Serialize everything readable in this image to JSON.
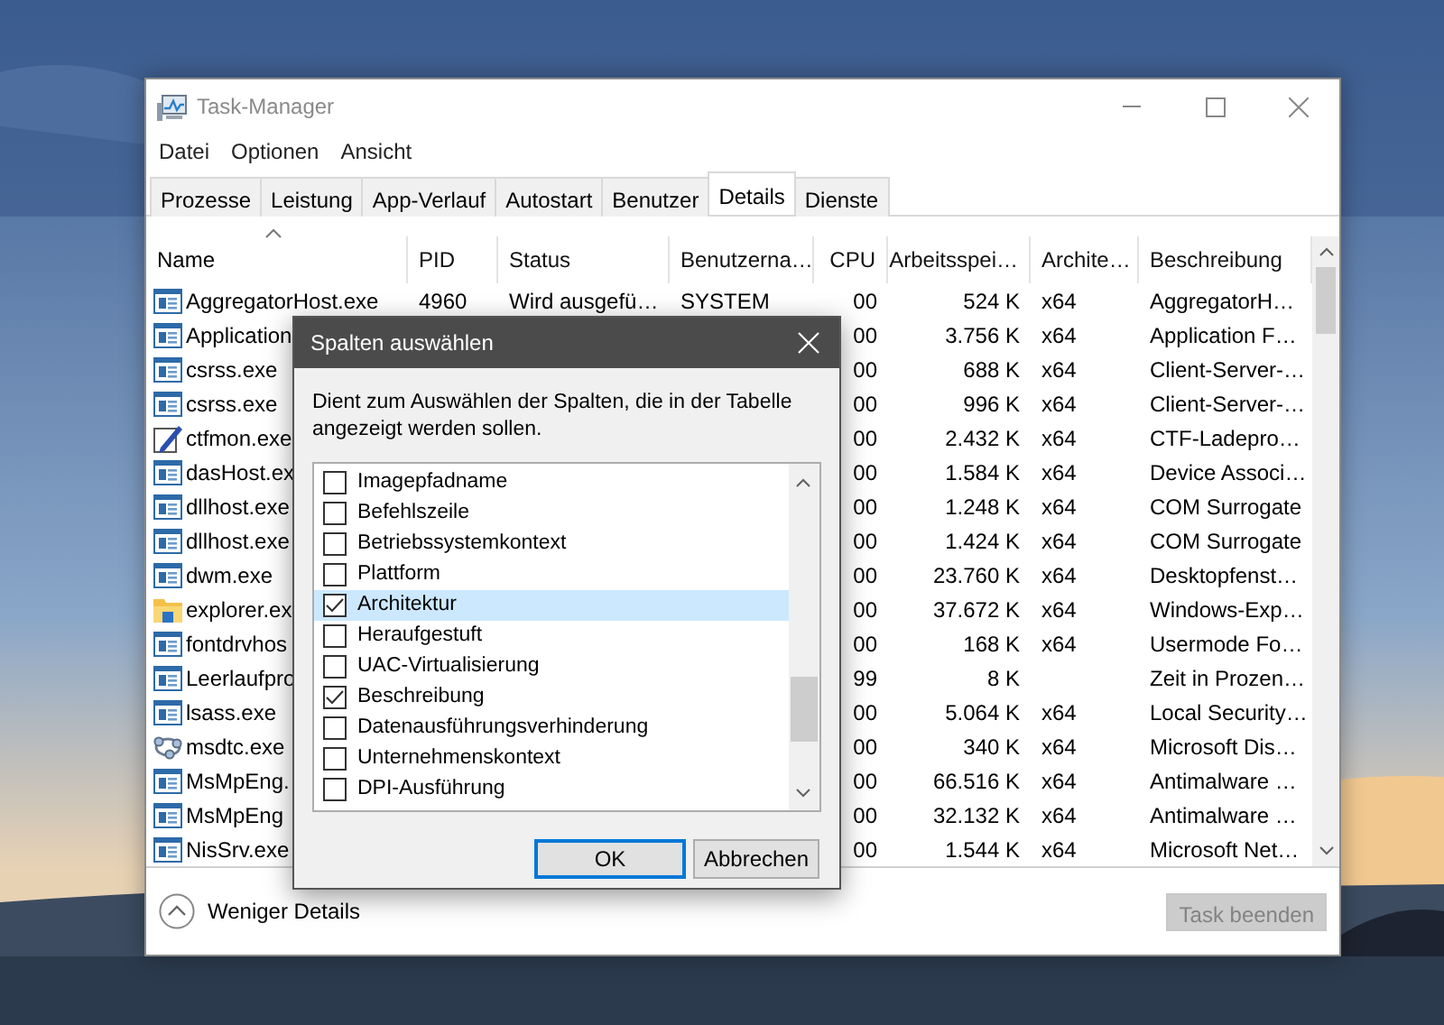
{
  "window": {
    "title": "Task-Manager"
  },
  "menu": [
    "Datei",
    "Optionen",
    "Ansicht"
  ],
  "tabs": [
    {
      "label": "Prozesse",
      "selected": false
    },
    {
      "label": "Leistung",
      "selected": false
    },
    {
      "label": "App-Verlauf",
      "selected": false
    },
    {
      "label": "Autostart",
      "selected": false
    },
    {
      "label": "Benutzer",
      "selected": false
    },
    {
      "label": "Details",
      "selected": true
    },
    {
      "label": "Dienste",
      "selected": false
    }
  ],
  "table": {
    "columns": [
      {
        "label": "Name",
        "sorted": true
      },
      {
        "label": "PID",
        "sorted": false
      },
      {
        "label": "Status",
        "sorted": false
      },
      {
        "label": "Benutzerna…",
        "sorted": false
      },
      {
        "label": "CPU",
        "sorted": false
      },
      {
        "label": "Arbeitsspei…",
        "sorted": false
      },
      {
        "label": "Archite…",
        "sorted": false
      },
      {
        "label": "Beschreibung",
        "sorted": false
      }
    ],
    "rows": [
      {
        "kind": "app",
        "name": "AggregatorHost.exe",
        "pid": "4960",
        "status": "Wird ausgefü…",
        "user": "SYSTEM",
        "cpu": "00",
        "memory": "524 K",
        "architecture": "x64",
        "description": "AggregatorH…"
      },
      {
        "kind": "app",
        "name": "Application",
        "cpu": "00",
        "memory": "3.756 K",
        "architecture": "x64",
        "description": "Application F…"
      },
      {
        "kind": "app",
        "name": "csrss.exe",
        "cpu": "00",
        "memory": "688 K",
        "architecture": "x64",
        "description": "Client-Server-…"
      },
      {
        "kind": "app",
        "name": "csrss.exe",
        "cpu": "00",
        "memory": "996 K",
        "architecture": "x64",
        "description": "Client-Server-…"
      },
      {
        "kind": "pen",
        "name": "ctfmon.exe",
        "cpu": "00",
        "memory": "2.432 K",
        "architecture": "x64",
        "description": "CTF-Ladepro…"
      },
      {
        "kind": "app",
        "name": "dasHost.ex",
        "cpu": "00",
        "memory": "1.584 K",
        "architecture": "x64",
        "description": "Device Associ…"
      },
      {
        "kind": "app",
        "name": "dllhost.exe",
        "cpu": "00",
        "memory": "1.248 K",
        "architecture": "x64",
        "description": "COM Surrogate"
      },
      {
        "kind": "app",
        "name": "dllhost.exe",
        "cpu": "00",
        "memory": "1.424 K",
        "architecture": "x64",
        "description": "COM Surrogate"
      },
      {
        "kind": "app",
        "name": "dwm.exe",
        "cpu": "00",
        "memory": "23.760 K",
        "architecture": "x64",
        "description": "Desktopfenst…"
      },
      {
        "kind": "folder",
        "name": "explorer.ex",
        "cpu": "00",
        "memory": "37.672 K",
        "architecture": "x64",
        "description": "Windows-Exp…"
      },
      {
        "kind": "app",
        "name": "fontdrvhos",
        "cpu": "00",
        "memory": "168 K",
        "architecture": "x64",
        "description": "Usermode Fo…"
      },
      {
        "kind": "app",
        "name": "Leerlaufpro",
        "cpu": "99",
        "memory": "8 K",
        "description": "Zeit in Prozen…"
      },
      {
        "kind": "app",
        "name": "lsass.exe",
        "cpu": "00",
        "memory": "5.064 K",
        "architecture": "x64",
        "description": "Local Security…"
      },
      {
        "kind": "network",
        "name": "msdtc.exe",
        "cpu": "00",
        "memory": "340 K",
        "architecture": "x64",
        "description": "Microsoft Dis…"
      },
      {
        "kind": "app",
        "name": "MsMpEng.",
        "cpu": "00",
        "memory": "66.516 K",
        "architecture": "x64",
        "description": "Antimalware …"
      },
      {
        "kind": "app",
        "name": "MsMpEng",
        "cpu": "00",
        "memory": "32.132 K",
        "architecture": "x64",
        "description": "Antimalware …"
      },
      {
        "kind": "app",
        "name": "NisSrv.exe",
        "cpu": "00",
        "memory": "1.544 K",
        "architecture": "x64",
        "description": "Microsoft Net…"
      }
    ]
  },
  "dialog": {
    "title": "Spalten auswählen",
    "description": "Dient zum Auswählen der Spalten, die in der Tabelle angezeigt werden sollen.",
    "items": [
      {
        "label": "Imagepfadname",
        "checked": false,
        "selected": false
      },
      {
        "label": "Befehlszeile",
        "checked": false,
        "selected": false
      },
      {
        "label": "Betriebssystemkontext",
        "checked": false,
        "selected": false
      },
      {
        "label": "Plattform",
        "checked": false,
        "selected": false
      },
      {
        "label": "Architektur",
        "checked": true,
        "selected": true
      },
      {
        "label": "Heraufgestuft",
        "checked": false,
        "selected": false
      },
      {
        "label": "UAC-Virtualisierung",
        "checked": false,
        "selected": false
      },
      {
        "label": "Beschreibung",
        "checked": true,
        "selected": false
      },
      {
        "label": "Datenausführungsverhinderung",
        "checked": false,
        "selected": false
      },
      {
        "label": "Unternehmenskontext",
        "checked": false,
        "selected": false
      },
      {
        "label": "DPI-Ausführung",
        "checked": false,
        "selected": false
      }
    ],
    "buttons": [
      {
        "label": "OK",
        "default": true
      },
      {
        "label": "Abbrechen",
        "default": false
      }
    ]
  },
  "footer": {
    "toggle": "Weniger Details",
    "end_task": {
      "label": "Task beenden",
      "disabled": true
    }
  }
}
